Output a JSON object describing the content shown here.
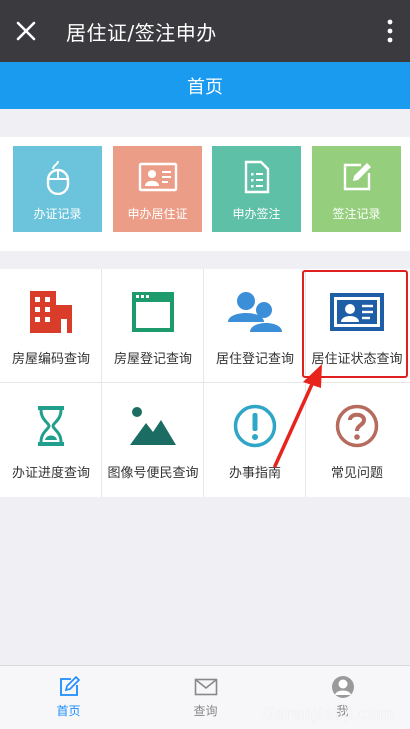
{
  "header": {
    "title": "居住证/签注申办",
    "close_icon": "close-icon",
    "more_icon": "more-vertical-icon"
  },
  "navbar": {
    "title": "首页"
  },
  "quick_tiles": [
    {
      "label": "办证记录",
      "icon": "mouse-icon",
      "color": "#6cc4dc"
    },
    {
      "label": "申办居住证",
      "icon": "id-card-icon",
      "color": "#ec9d88"
    },
    {
      "label": "申办签注",
      "icon": "document-icon",
      "color": "#5ec0a6"
    },
    {
      "label": "签注记录",
      "icon": "edit-icon",
      "color": "#95cf7d"
    }
  ],
  "grid": [
    {
      "label": "房屋编码查询",
      "icon": "building-icon"
    },
    {
      "label": "房屋登记查询",
      "icon": "browser-window-icon"
    },
    {
      "label": "居住登记查询",
      "icon": "users-icon"
    },
    {
      "label": "居住证状态查询",
      "icon": "id-card-icon"
    },
    {
      "label": "办证进度查询",
      "icon": "hourglass-icon"
    },
    {
      "label": "图像号便民查询",
      "icon": "image-icon"
    },
    {
      "label": "办事指南",
      "icon": "exclamation-icon"
    },
    {
      "label": "常见问题",
      "icon": "question-icon"
    }
  ],
  "tabbar": [
    {
      "label": "首页",
      "icon": "edit-icon",
      "active": true
    },
    {
      "label": "查询",
      "icon": "mail-icon",
      "active": false
    },
    {
      "label": "我",
      "icon": "user-icon",
      "active": false
    }
  ],
  "watermark": "Gerenjiaoji.com",
  "colors": {
    "navbar": "#1a9bf0",
    "titlebar": "#3b3b3f",
    "highlight": "#e02020",
    "active_tab": "#1a8cff"
  }
}
